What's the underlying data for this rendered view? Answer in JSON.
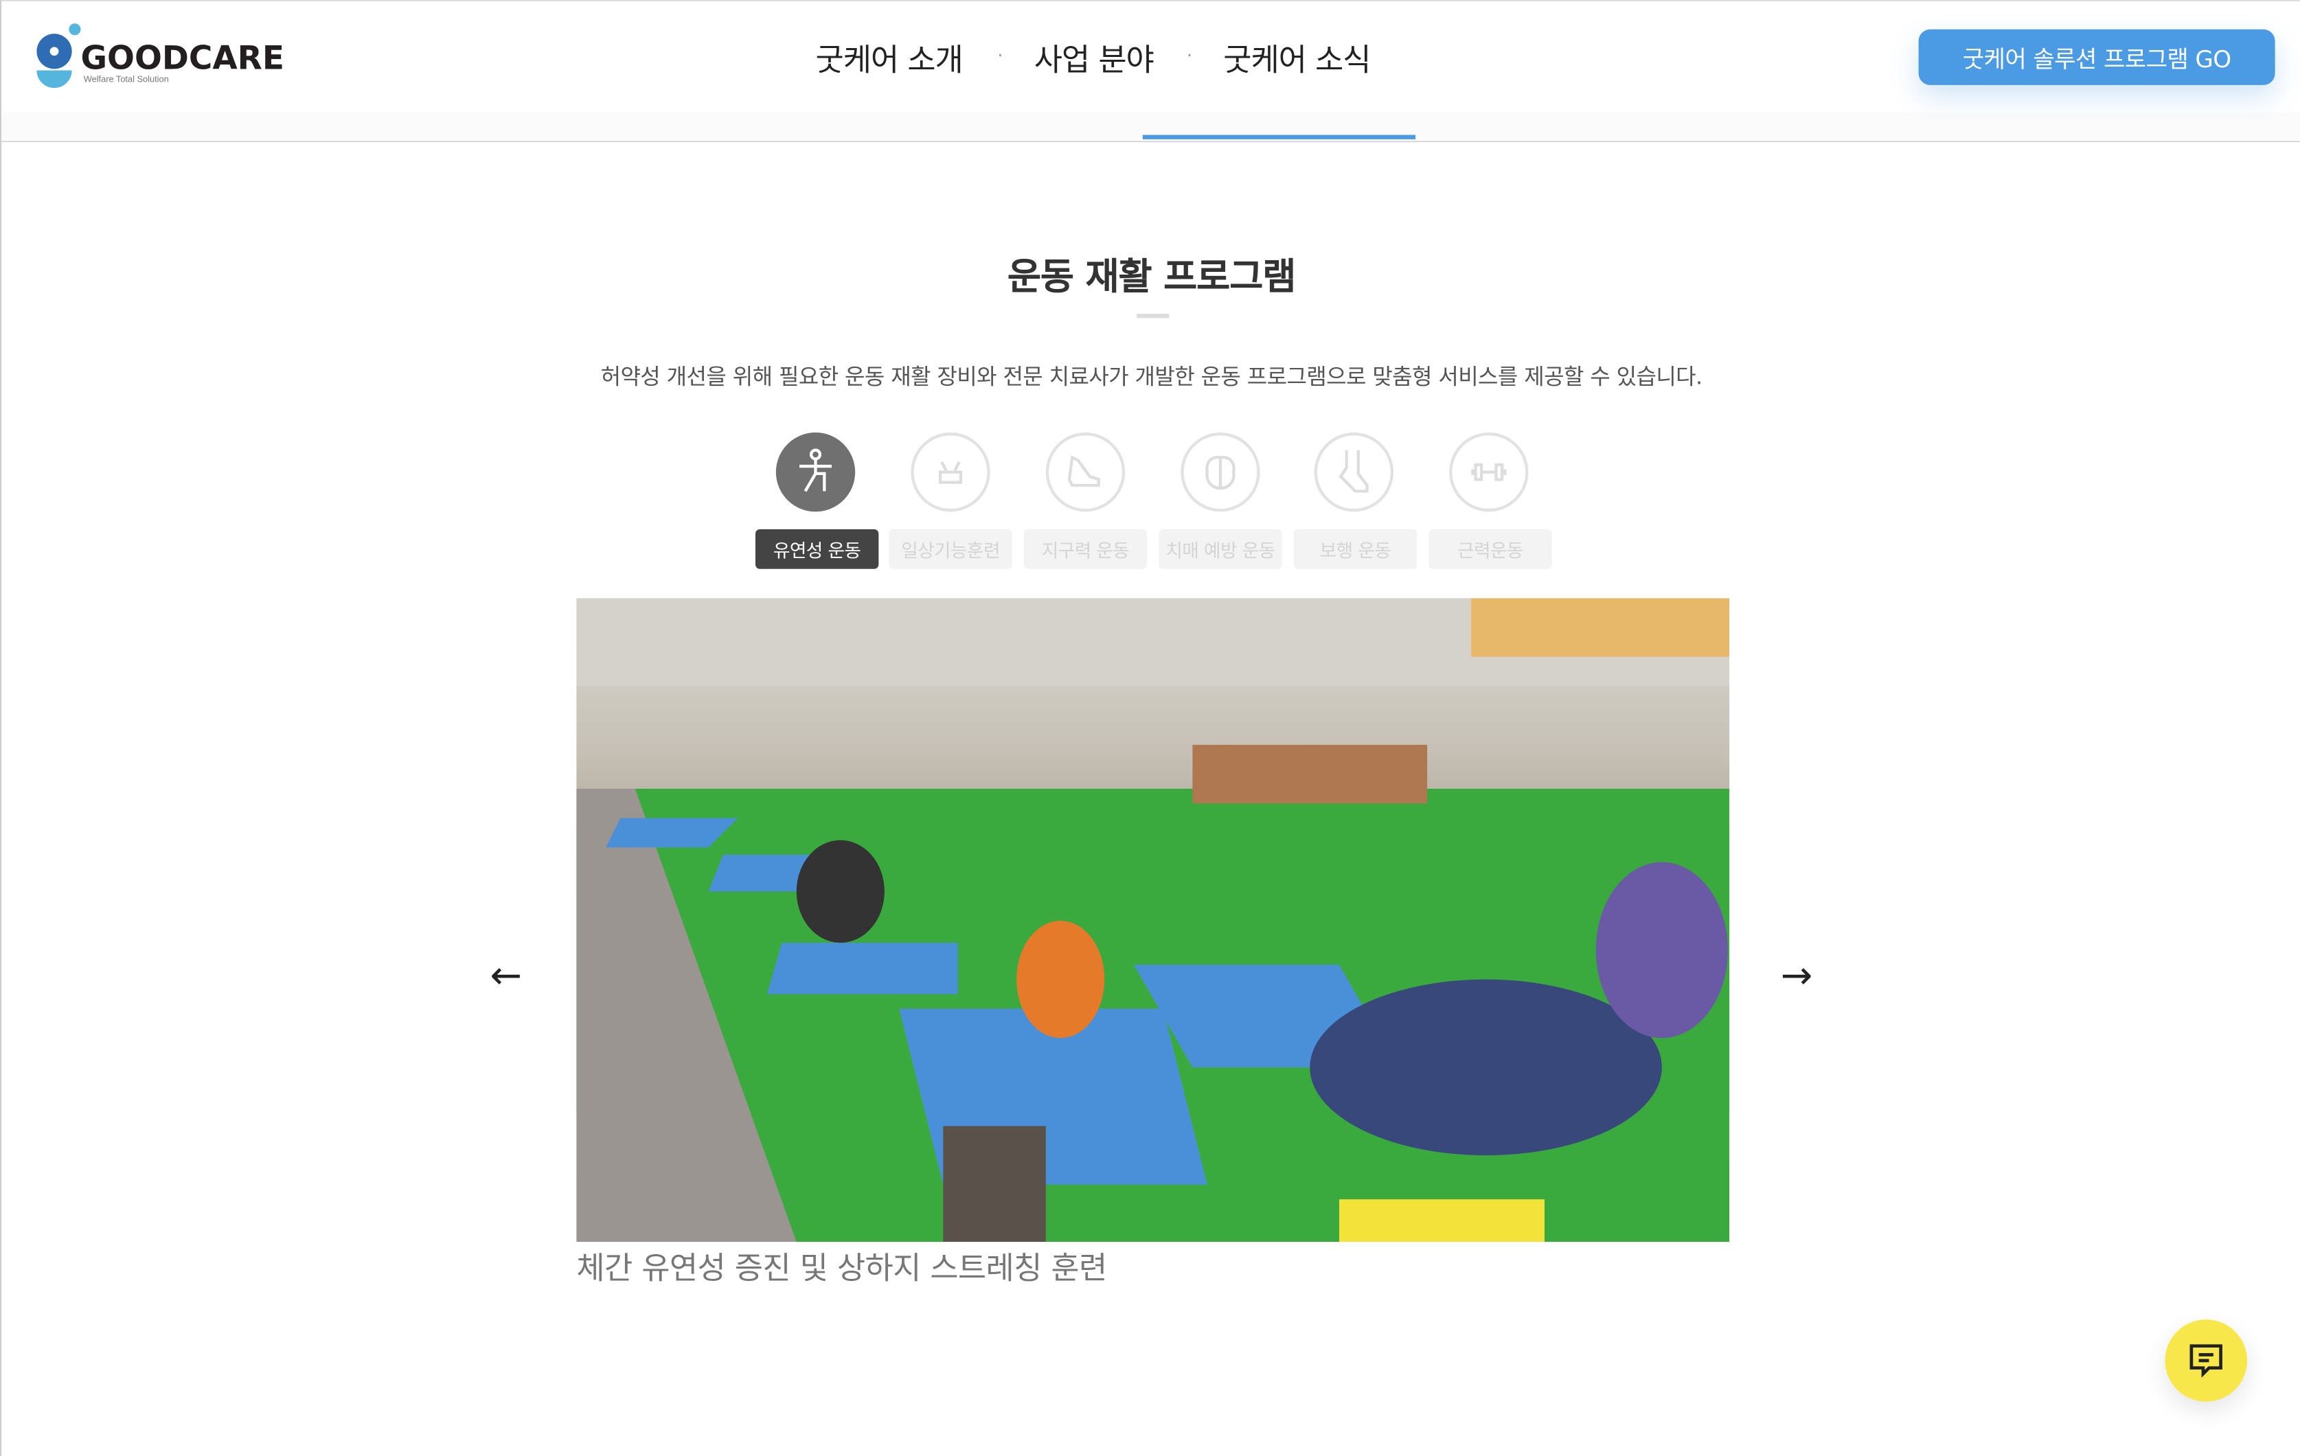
{
  "header": {
    "logo": {
      "name": "GOODCARE",
      "tagline": "Welfare Total Solution"
    },
    "nav": [
      {
        "label": "굿케어 소개"
      },
      {
        "label": "사업 분야"
      },
      {
        "label": "굿케어 소식"
      }
    ],
    "nav_separator": "·",
    "cta_label": "굿케어 솔루션 프로그램 GO"
  },
  "main": {
    "title": "운동 재활 프로그램",
    "subtitle": "허약성 개선을 위해 필요한 운동 재활 장비와 전문 치료사가 개발한 운동 프로그램으로 맞춤형 서비스를 제공할 수 있습니다.",
    "tabs": [
      {
        "label": "유연성 운동",
        "icon": "stretching-person-icon",
        "active": true
      },
      {
        "label": "일상기능훈련",
        "icon": "daily-function-icon",
        "active": false
      },
      {
        "label": "지구력 운동",
        "icon": "sneaker-icon",
        "active": false
      },
      {
        "label": "치매 예방 운동",
        "icon": "brain-icon",
        "active": false
      },
      {
        "label": "보행 운동",
        "icon": "walking-shoe-icon",
        "active": false
      },
      {
        "label": "근력운동",
        "icon": "dumbbell-icon",
        "active": false
      }
    ],
    "slide": {
      "caption": "체간 유연성 증진 및 상하지 스트레칭 훈련"
    },
    "prev_icon": "←",
    "next_icon": "→"
  },
  "colors": {
    "accent": "#4a9ae4",
    "active_tab": "#444444",
    "chat": "#f7e74a"
  }
}
